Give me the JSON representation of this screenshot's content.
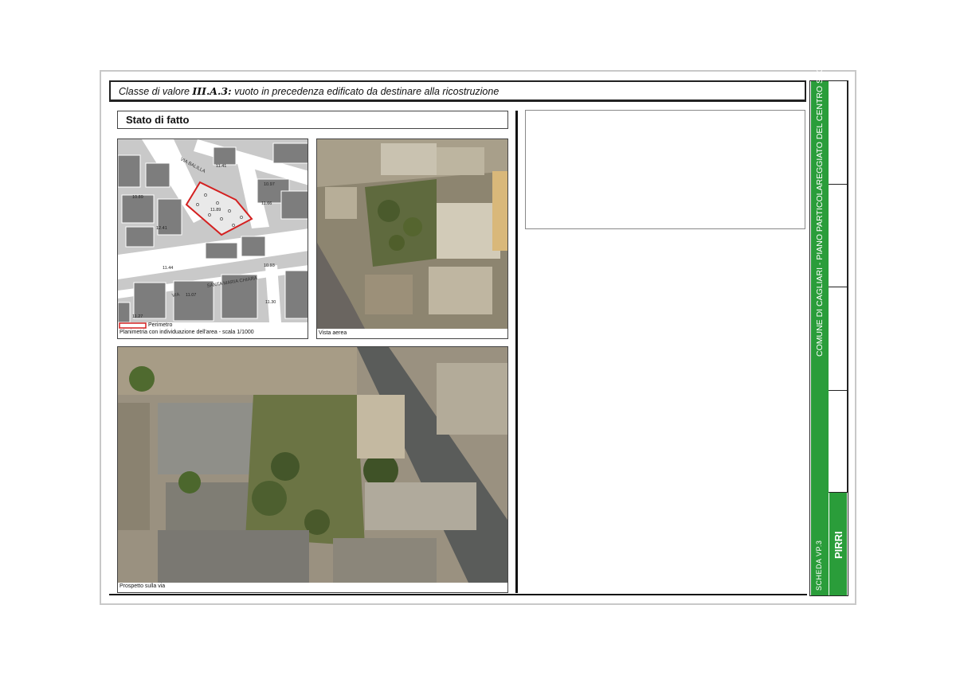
{
  "header": {
    "prefix": "Classe di valore ",
    "code": "III.A.3:",
    "description": " vuoto in precedenza edificato da destinare alla ricostruzione"
  },
  "section": {
    "title": "Stato di fatto"
  },
  "map_panel": {
    "legend_label": "Perimetro",
    "caption": "Planimetria con individuazione dell'area - scala 1/1000",
    "street_labels": [
      "VIA BALILLA",
      "SANTA MARIA CHIARA",
      "VIA"
    ],
    "elevations": [
      "11.41",
      "10.97",
      "11.66",
      "11.89",
      "12.41",
      "11.44",
      "10.93",
      "11.07",
      "11.27",
      "10.89",
      "11.30"
    ],
    "perimeter_color": "#d42020"
  },
  "aerial_panel": {
    "caption": "Vista aerea"
  },
  "street_panel": {
    "caption": "Prospetto sulla via"
  },
  "sidebar": {
    "title": "COMUNE DI CAGLIARI - PIANO PARTICOLAREGGIATO DEL CENTRO STORICO",
    "scheda": "SCHEDA   VP.3",
    "district": "PIRRI",
    "accent_color": "#2a9d3a"
  }
}
